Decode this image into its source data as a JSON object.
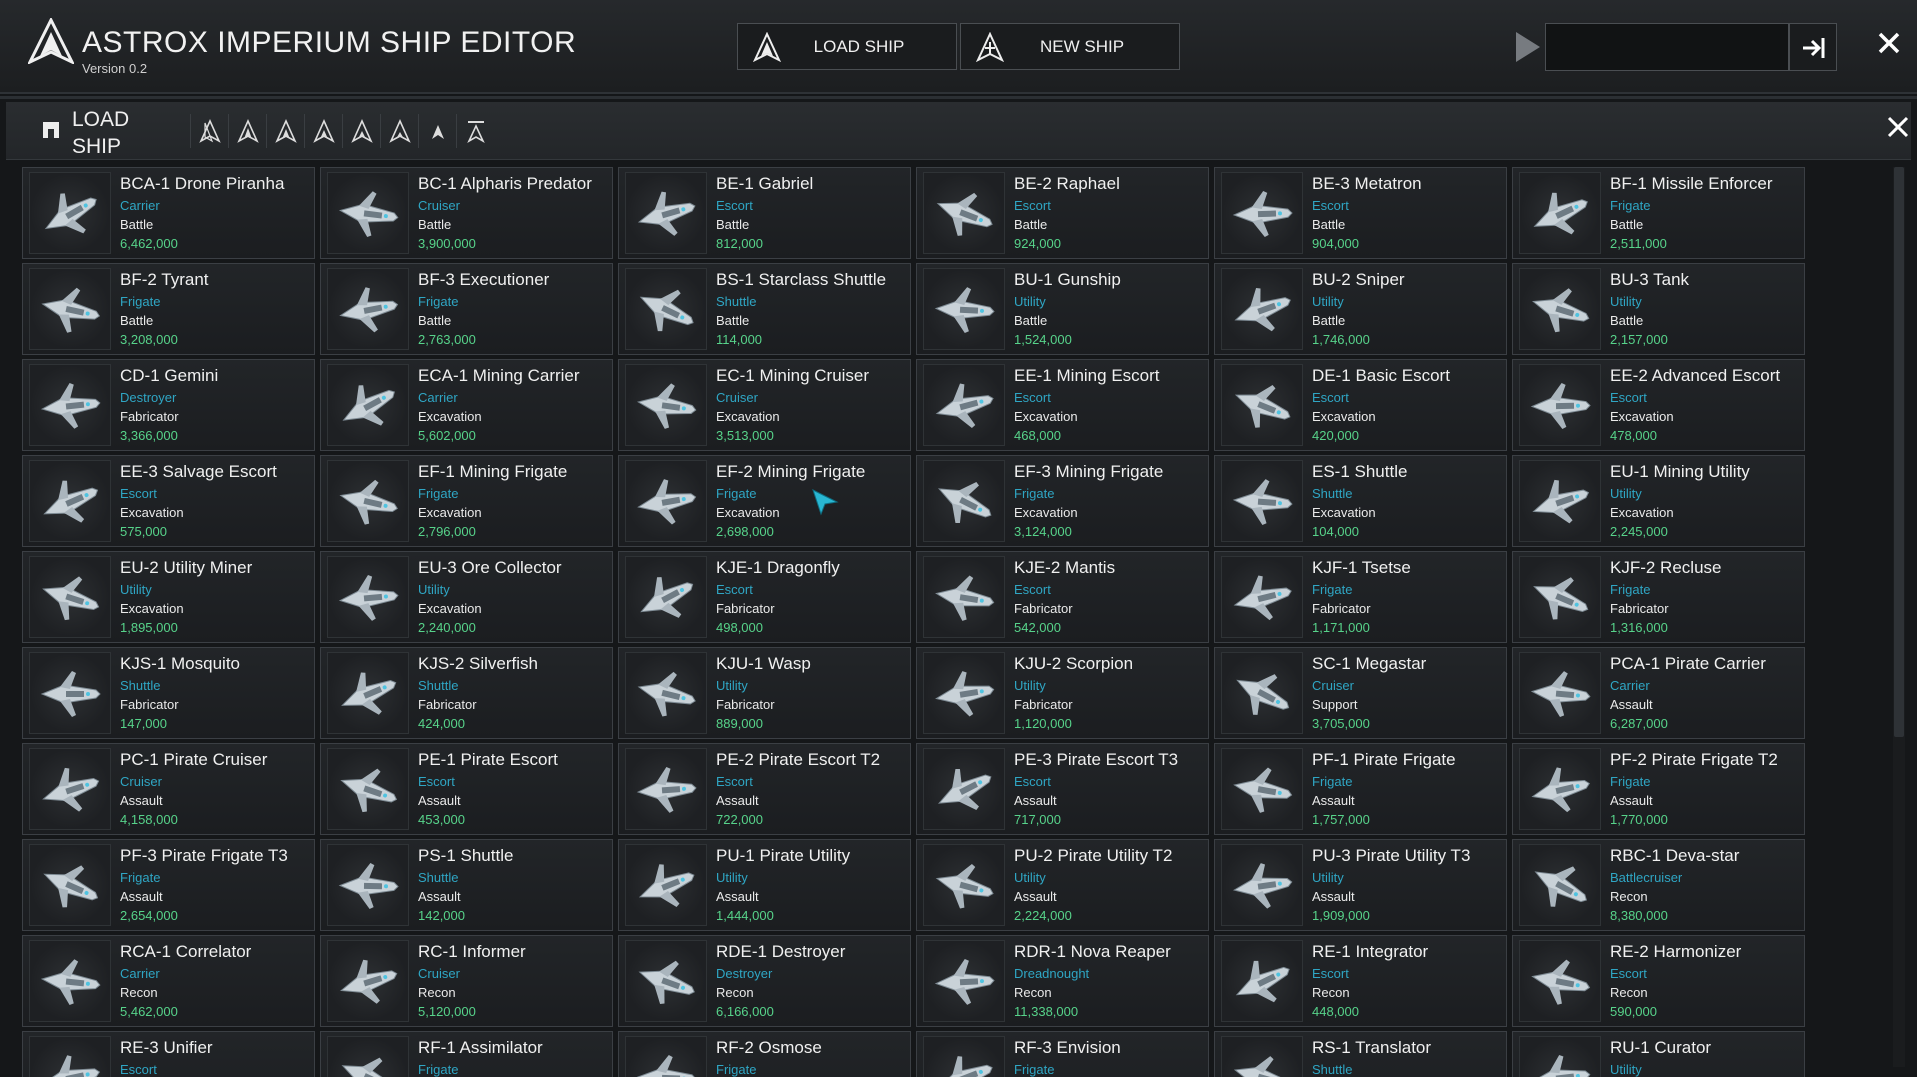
{
  "app": {
    "title": "ASTROX IMPERIUM SHIP EDITOR",
    "version": "Version 0.2",
    "load_ship_label": "LOAD SHIP",
    "new_ship_label": "NEW SHIP",
    "search_value": "",
    "accent_color": "#2fa6c4",
    "price_color": "#57d38a"
  },
  "panel": {
    "title": "LOAD SHIP",
    "filter_icons": [
      "all-ships-icon",
      "frigate-icon",
      "shuttle-icon",
      "escort-icon",
      "cruiser-icon",
      "carrier-icon",
      "utility-icon",
      "destroyer-icon"
    ]
  },
  "ships": [
    {
      "name": "BCA-1 Drone Piranha",
      "cls": "Carrier",
      "role": "Battle",
      "price": "6,462,000"
    },
    {
      "name": "BC-1 Alpharis Predator",
      "cls": "Cruiser",
      "role": "Battle",
      "price": "3,900,000"
    },
    {
      "name": "BE-1 Gabriel",
      "cls": "Escort",
      "role": "Battle",
      "price": "812,000"
    },
    {
      "name": "BE-2 Raphael",
      "cls": "Escort",
      "role": "Battle",
      "price": "924,000"
    },
    {
      "name": "BE-3 Metatron",
      "cls": "Escort",
      "role": "Battle",
      "price": "904,000"
    },
    {
      "name": "BF-1 Missile Enforcer",
      "cls": "Frigate",
      "role": "Battle",
      "price": "2,511,000"
    },
    {
      "name": "BF-2 Tyrant",
      "cls": "Frigate",
      "role": "Battle",
      "price": "3,208,000"
    },
    {
      "name": "BF-3 Executioner",
      "cls": "Frigate",
      "role": "Battle",
      "price": "2,763,000"
    },
    {
      "name": "BS-1 Starclass Shuttle",
      "cls": "Shuttle",
      "role": "Battle",
      "price": "114,000"
    },
    {
      "name": "BU-1 Gunship",
      "cls": "Utility",
      "role": "Battle",
      "price": "1,524,000"
    },
    {
      "name": "BU-2 Sniper",
      "cls": "Utility",
      "role": "Battle",
      "price": "1,746,000"
    },
    {
      "name": "BU-3 Tank",
      "cls": "Utility",
      "role": "Battle",
      "price": "2,157,000"
    },
    {
      "name": "CD-1 Gemini",
      "cls": "Destroyer",
      "role": "Fabricator",
      "price": "3,366,000"
    },
    {
      "name": "ECA-1 Mining Carrier",
      "cls": "Carrier",
      "role": "Excavation",
      "price": "5,602,000"
    },
    {
      "name": "EC-1 Mining Cruiser",
      "cls": "Cruiser",
      "role": "Excavation",
      "price": "3,513,000"
    },
    {
      "name": "EE-1 Mining Escort",
      "cls": "Escort",
      "role": "Excavation",
      "price": "468,000"
    },
    {
      "name": "DE-1 Basic Escort",
      "cls": "Escort",
      "role": "Excavation",
      "price": "420,000"
    },
    {
      "name": "EE-2 Advanced Escort",
      "cls": "Escort",
      "role": "Excavation",
      "price": "478,000"
    },
    {
      "name": "EE-3 Salvage Escort",
      "cls": "Escort",
      "role": "Excavation",
      "price": "575,000"
    },
    {
      "name": "EF-1 Mining Frigate",
      "cls": "Frigate",
      "role": "Excavation",
      "price": "2,796,000"
    },
    {
      "name": "EF-2 Mining Frigate",
      "cls": "Frigate",
      "role": "Excavation",
      "price": "2,698,000"
    },
    {
      "name": "EF-3 Mining Frigate",
      "cls": "Frigate",
      "role": "Excavation",
      "price": "3,124,000"
    },
    {
      "name": "ES-1 Shuttle",
      "cls": "Shuttle",
      "role": "Excavation",
      "price": "104,000"
    },
    {
      "name": "EU-1 Mining Utility",
      "cls": "Utility",
      "role": "Excavation",
      "price": "2,245,000"
    },
    {
      "name": "EU-2 Utility Miner",
      "cls": "Utility",
      "role": "Excavation",
      "price": "1,895,000"
    },
    {
      "name": "EU-3 Ore Collector",
      "cls": "Utility",
      "role": "Excavation",
      "price": "2,240,000"
    },
    {
      "name": "KJE-1 Dragonfly",
      "cls": "Escort",
      "role": "Fabricator",
      "price": "498,000"
    },
    {
      "name": "KJE-2 Mantis",
      "cls": "Escort",
      "role": "Fabricator",
      "price": "542,000"
    },
    {
      "name": "KJF-1 Tsetse",
      "cls": "Frigate",
      "role": "Fabricator",
      "price": "1,171,000"
    },
    {
      "name": "KJF-2 Recluse",
      "cls": "Frigate",
      "role": "Fabricator",
      "price": "1,316,000"
    },
    {
      "name": "KJS-1 Mosquito",
      "cls": "Shuttle",
      "role": "Fabricator",
      "price": "147,000"
    },
    {
      "name": "KJS-2 Silverfish",
      "cls": "Shuttle",
      "role": "Fabricator",
      "price": "424,000"
    },
    {
      "name": "KJU-1 Wasp",
      "cls": "Utility",
      "role": "Fabricator",
      "price": "889,000"
    },
    {
      "name": "KJU-2 Scorpion",
      "cls": "Utility",
      "role": "Fabricator",
      "price": "1,120,000"
    },
    {
      "name": "SC-1 Megastar",
      "cls": "Cruiser",
      "role": "Support",
      "price": "3,705,000"
    },
    {
      "name": "PCA-1 Pirate Carrier",
      "cls": "Carrier",
      "role": "Assault",
      "price": "6,287,000"
    },
    {
      "name": "PC-1 Pirate Cruiser",
      "cls": "Cruiser",
      "role": "Assault",
      "price": "4,158,000"
    },
    {
      "name": "PE-1 Pirate Escort",
      "cls": "Escort",
      "role": "Assault",
      "price": "453,000"
    },
    {
      "name": "PE-2 Pirate Escort T2",
      "cls": "Escort",
      "role": "Assault",
      "price": "722,000"
    },
    {
      "name": "PE-3 Pirate Escort T3",
      "cls": "Escort",
      "role": "Assault",
      "price": "717,000"
    },
    {
      "name": "PF-1 Pirate Frigate",
      "cls": "Frigate",
      "role": "Assault",
      "price": "1,757,000"
    },
    {
      "name": "PF-2 Pirate Frigate T2",
      "cls": "Frigate",
      "role": "Assault",
      "price": "1,770,000"
    },
    {
      "name": "PF-3 Pirate Frigate T3",
      "cls": "Frigate",
      "role": "Assault",
      "price": "2,654,000"
    },
    {
      "name": "PS-1 Shuttle",
      "cls": "Shuttle",
      "role": "Assault",
      "price": "142,000"
    },
    {
      "name": "PU-1 Pirate Utility",
      "cls": "Utility",
      "role": "Assault",
      "price": "1,444,000"
    },
    {
      "name": "PU-2 Pirate Utility T2",
      "cls": "Utility",
      "role": "Assault",
      "price": "2,224,000"
    },
    {
      "name": "PU-3 Pirate Utility T3",
      "cls": "Utility",
      "role": "Assault",
      "price": "1,909,000"
    },
    {
      "name": "RBC-1 Deva-star",
      "cls": "Battlecruiser",
      "role": "Recon",
      "price": "8,380,000"
    },
    {
      "name": "RCA-1 Correlator",
      "cls": "Carrier",
      "role": "Recon",
      "price": "5,462,000"
    },
    {
      "name": "RC-1 Informer",
      "cls": "Cruiser",
      "role": "Recon",
      "price": "5,120,000"
    },
    {
      "name": "RDE-1 Destroyer",
      "cls": "Destroyer",
      "role": "Recon",
      "price": "6,166,000"
    },
    {
      "name": "RDR-1 Nova Reaper",
      "cls": "Dreadnought",
      "role": "Recon",
      "price": "11,338,000"
    },
    {
      "name": "RE-1 Integrator",
      "cls": "Escort",
      "role": "Recon",
      "price": "448,000"
    },
    {
      "name": "RE-2 Harmonizer",
      "cls": "Escort",
      "role": "Recon",
      "price": "590,000"
    },
    {
      "name": "RE-3 Unifier",
      "cls": "Escort",
      "role": "",
      "price": ""
    },
    {
      "name": "RF-1 Assimilator",
      "cls": "Frigate",
      "role": "",
      "price": ""
    },
    {
      "name": "RF-2 Osmose",
      "cls": "Frigate",
      "role": "",
      "price": ""
    },
    {
      "name": "RF-3 Envision",
      "cls": "Frigate",
      "role": "",
      "price": ""
    },
    {
      "name": "RS-1 Translator",
      "cls": "Shuttle",
      "role": "",
      "price": ""
    },
    {
      "name": "RU-1 Curator",
      "cls": "Utility",
      "role": "",
      "price": ""
    }
  ]
}
